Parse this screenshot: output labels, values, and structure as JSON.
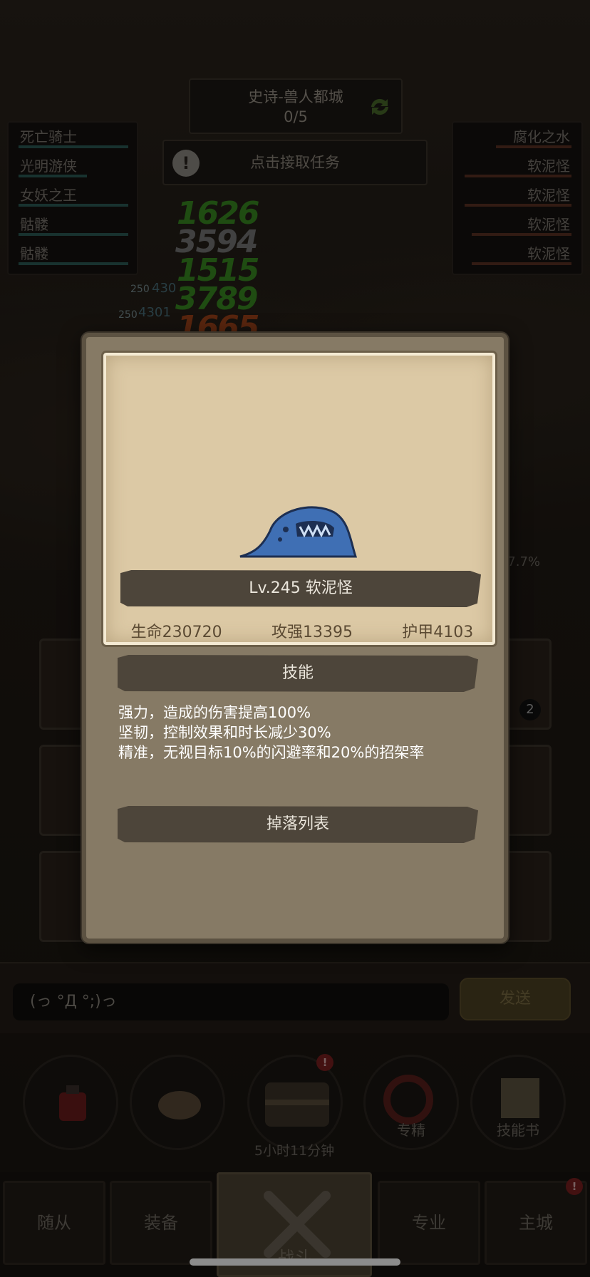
{
  "dungeon": {
    "title": "史诗-兽人都城",
    "progress": "0/5"
  },
  "quest": {
    "label": "点击接取任务"
  },
  "allies": [
    "死亡骑士",
    "光明游侠",
    "女妖之王",
    "骷髅",
    "骷髅"
  ],
  "enemies": [
    "腐化之水",
    "软泥怪",
    "软泥怪",
    "软泥怪",
    "软泥怪"
  ],
  "damage_numbers": [
    "1626",
    "3594",
    "1515",
    "3789",
    "1665"
  ],
  "hp_tags": [
    "250",
    "430",
    "250",
    "4301"
  ],
  "percent_readout": "7.7%",
  "stack_count": "2",
  "modal": {
    "monster_name": "Lv.245 软泥怪",
    "stats": {
      "hp": "生命230720",
      "attack": "攻强13395",
      "armor": "护甲4103"
    },
    "skills_title": "技能",
    "skills": [
      "强力，造成的伤害提高100%",
      "坚韧，控制效果和时长减少30%",
      "精准，无视目标10%的闪避率和20%的招架率"
    ],
    "drops_title": "掉落列表"
  },
  "chat": {
    "placeholder": "(っ °Д °;)っ",
    "send_label": "发送"
  },
  "actions": {
    "specialization": "专精",
    "skill_book": "技能书",
    "chest_timer": "5小时11分钟",
    "badge": "!"
  },
  "nav": {
    "followers": "随从",
    "equipment": "装备",
    "battle": "战斗",
    "profession": "专业",
    "main_city": "主城"
  },
  "colors": {
    "parchment": "#dcc9a5",
    "frame": "#867a65",
    "banner": "#4d453a",
    "slime": "#3f6fb4"
  }
}
